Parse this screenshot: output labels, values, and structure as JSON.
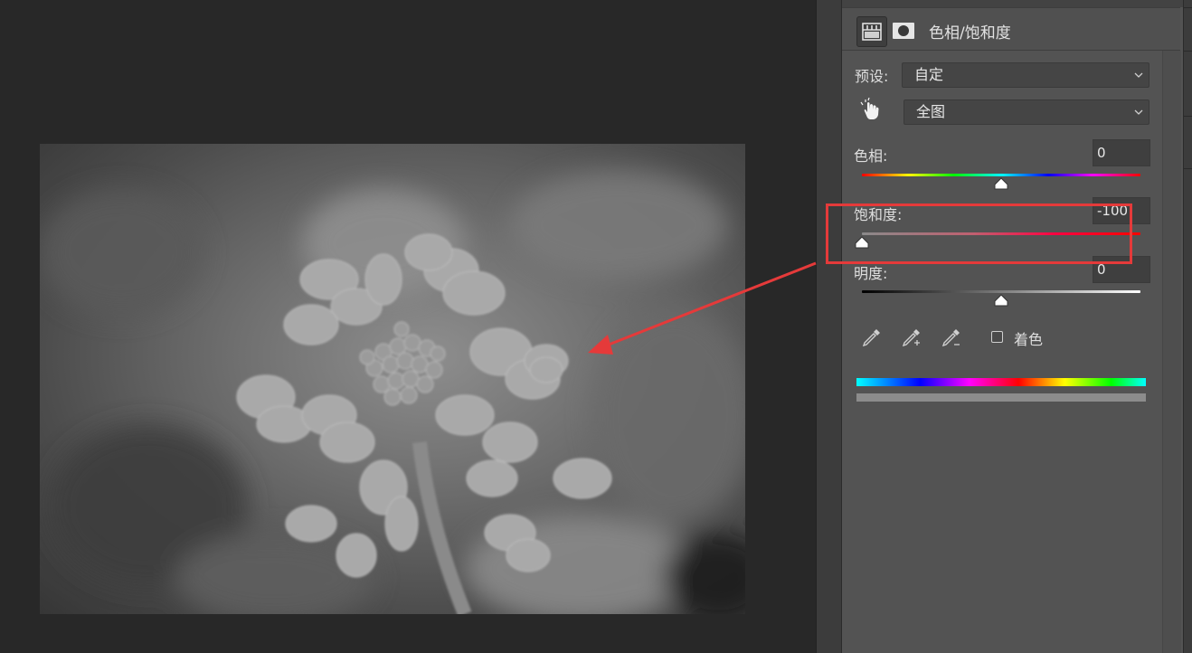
{
  "panel": {
    "title": "色相/饱和度",
    "preset_label": "预设:",
    "preset_value": "自定",
    "channel_value": "全图",
    "hue_label": "色相:",
    "hue_value": "0",
    "saturation_label": "饱和度:",
    "saturation_value": "-100",
    "lightness_label": "明度:",
    "lightness_value": "0",
    "colorize_label": "着色",
    "colorize_checked": false
  },
  "sliders": {
    "hue": {
      "min": -180,
      "max": 180,
      "value": 0
    },
    "saturation": {
      "min": -100,
      "max": 100,
      "value": -100
    },
    "lightness": {
      "min": -100,
      "max": 100,
      "value": 0
    }
  },
  "icons": {
    "adjustment": "hue-saturation-adjustment-icon",
    "mask": "layer-mask-icon",
    "targeted_adjust": "hand-pointer-icon",
    "eyedroppers": [
      "eyedropper-icon",
      "eyedropper-add-icon",
      "eyedropper-subtract-icon"
    ]
  },
  "colors": {
    "annotation": "#e53a3a",
    "panel_bg": "#535353",
    "canvas_bg": "#282828"
  }
}
